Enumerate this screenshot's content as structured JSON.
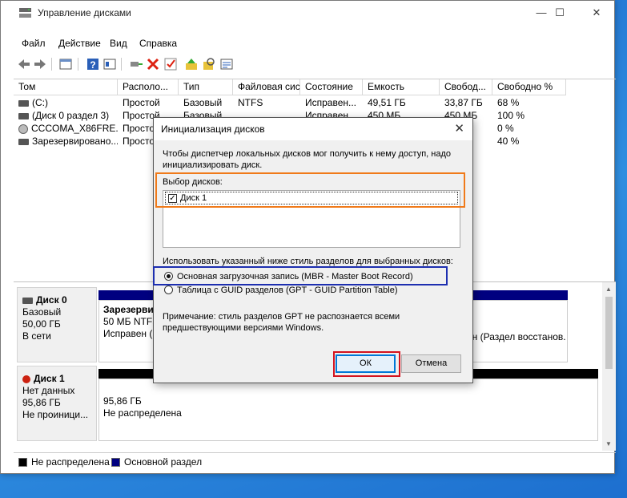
{
  "window": {
    "title": "Управление дисками",
    "minimize": "—",
    "maximize": "☐",
    "close": "✕"
  },
  "menu": [
    "Файл",
    "Действие",
    "Вид",
    "Справка"
  ],
  "columns": [
    "Том",
    "Располо...",
    "Тип",
    "Файловая сис...",
    "Состояние",
    "Емкость",
    "Свобод...",
    "Свободно %"
  ],
  "volumes": [
    {
      "name": "(C:)",
      "layout": "Простой",
      "type": "Базовый",
      "fs": "NTFS",
      "status": "Исправен...",
      "capacity": "49,51 ГБ",
      "free": "33,87 ГБ",
      "free_pct": "68 %"
    },
    {
      "name": "(Диск 0 раздел 3)",
      "layout": "Простой",
      "type": "Базовый",
      "fs": "",
      "status": "Исправен...",
      "capacity": "450 МБ",
      "free": "450 МБ",
      "free_pct": "100 %"
    },
    {
      "name": "CCCOMA_X86FRE...",
      "layout": "Просто",
      "type": "",
      "fs": "",
      "status": "",
      "capacity": "",
      "free": "",
      "free_pct": "0 %"
    },
    {
      "name": "Зарезервировано...",
      "layout": "Просто",
      "type": "",
      "fs": "",
      "status": "",
      "capacity": "",
      "free": "",
      "free_pct": "40 %"
    }
  ],
  "disks": [
    {
      "name": "Диск 0",
      "kind": "Базовый",
      "size": "50,00 ГБ",
      "status": "В сети",
      "part1_title": "Зарезерви",
      "part1_line2": "50 МБ NTFS",
      "part1_line3": "Исправен (",
      "part_right_text": "ен (Раздел восстанов."
    },
    {
      "name": "Диск 1",
      "kind": "Нет данных",
      "size": "95,86 ГБ",
      "status": "Не проиници...",
      "unalloc_size": "95,86 ГБ",
      "unalloc_label": "Не распределена"
    }
  ],
  "legend": [
    {
      "label": "Не распределена",
      "color": "#000000"
    },
    {
      "label": "Основной раздел",
      "color": "#000080"
    }
  ],
  "dialog": {
    "title": "Инициализация дисков",
    "intro_line1": "Чтобы диспетчер локальных дисков мог получить к нему доступ, надо",
    "intro_line2": "инициализировать диск.",
    "select_label": "Выбор дисков:",
    "disk_item": "Диск 1",
    "disk_checked": true,
    "style_label": "Использовать указанный ниже стиль разделов для выбранных дисков:",
    "option_mbr": "Основная загрузочная запись (MBR - Master Boot Record)",
    "option_gpt": "Таблица с GUID разделов (GPT - GUID Partition Table)",
    "selected_option": "mbr",
    "note_line1": "Примечание: стиль разделов GPT не распознается всеми",
    "note_line2": "предшествующими версиями Windows.",
    "ok": "ОК",
    "cancel": "Отмена"
  },
  "highlight_colors": {
    "select_box": "#f07a1a",
    "mbr_box": "#1d2fb0",
    "ok_box": "#d3131f",
    "primary": "#000080"
  }
}
